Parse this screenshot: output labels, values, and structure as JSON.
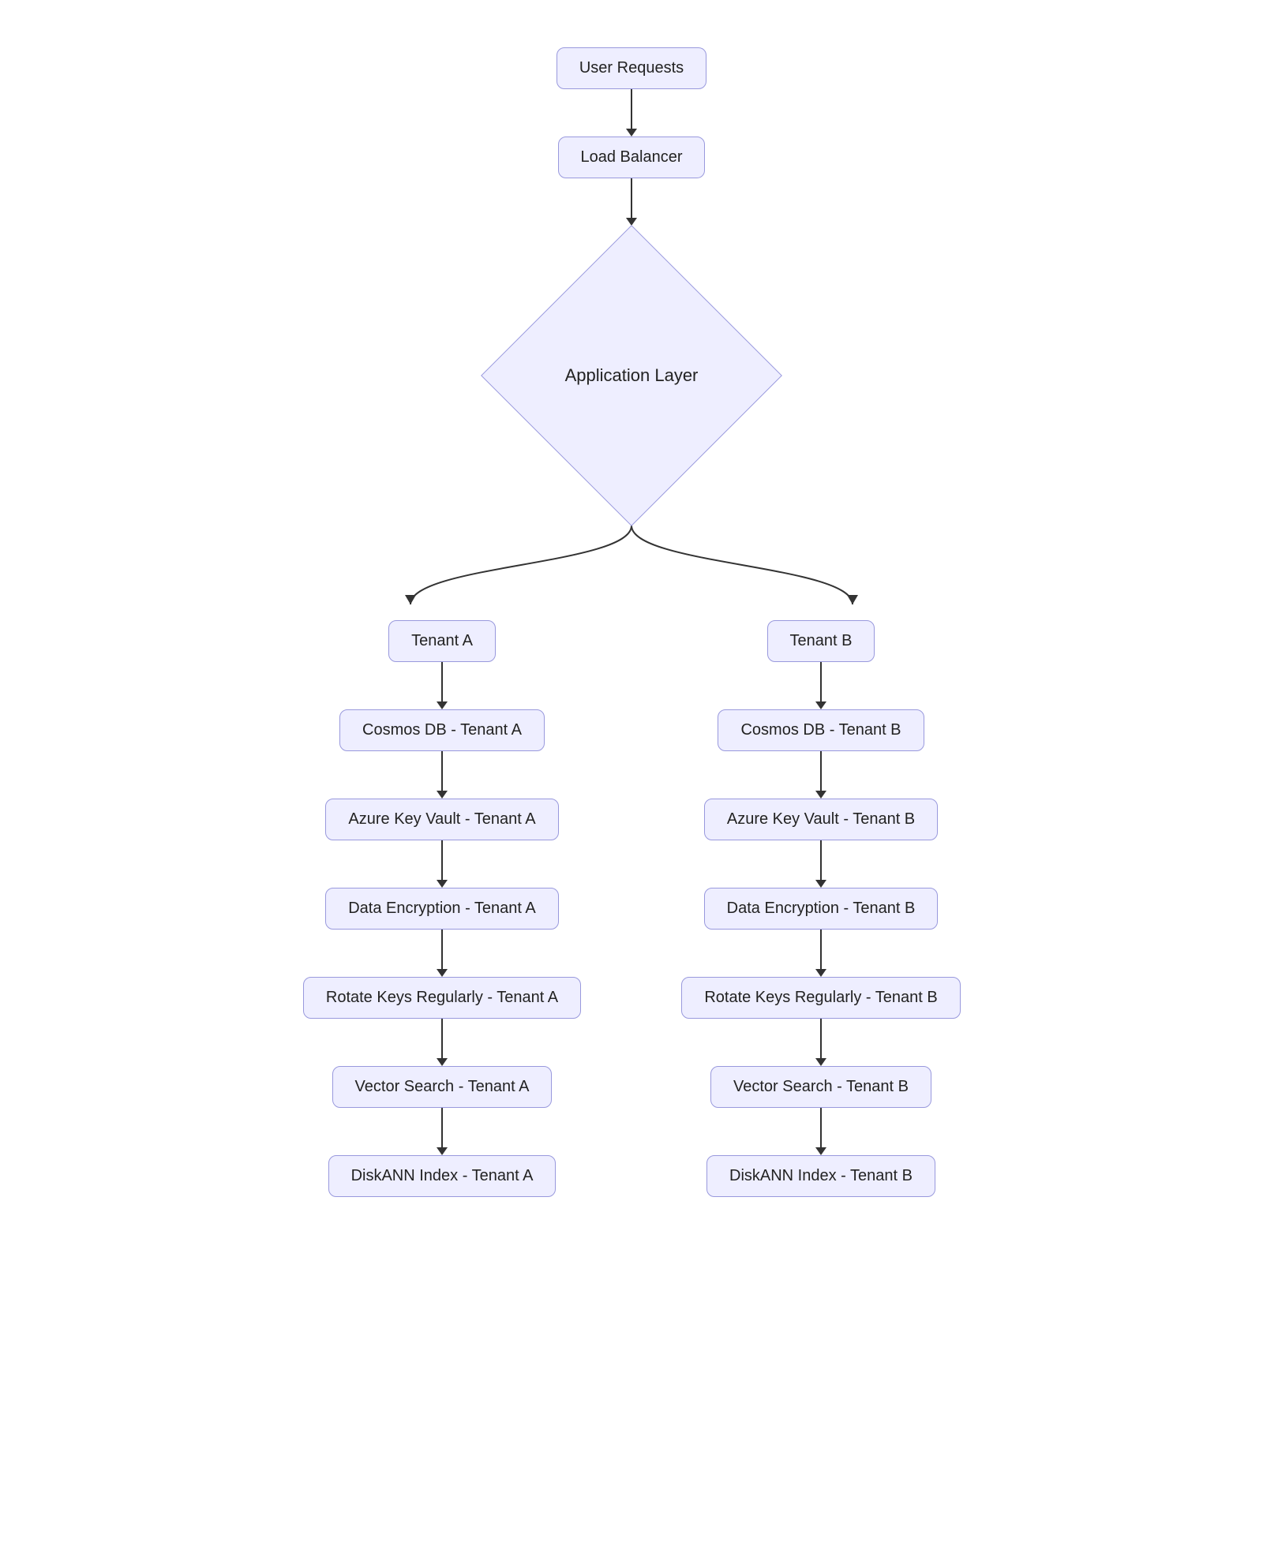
{
  "nodes": {
    "user_requests": "User Requests",
    "load_balancer": "Load Balancer",
    "application_layer": "Application Layer",
    "tenant_a": "Tenant A",
    "tenant_b": "Tenant B",
    "cosmos_a": "Cosmos DB - Tenant A",
    "cosmos_b": "Cosmos DB - Tenant B",
    "keyvault_a": "Azure Key Vault - Tenant A",
    "keyvault_b": "Azure Key Vault - Tenant B",
    "encryption_a": "Data Encryption - Tenant A",
    "encryption_b": "Data Encryption - Tenant B",
    "rotate_a": "Rotate Keys Regularly - Tenant A",
    "rotate_b": "Rotate Keys Regularly - Tenant B",
    "vector_a": "Vector Search - Tenant A",
    "vector_b": "Vector Search - Tenant B",
    "diskann_a": "DiskANN Index - Tenant A",
    "diskann_b": "DiskANN Index - Tenant B"
  }
}
